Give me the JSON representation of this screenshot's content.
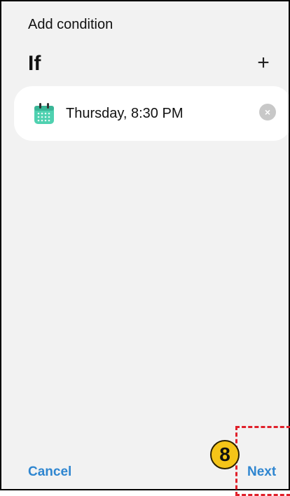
{
  "header": {
    "title": "Add condition"
  },
  "section": {
    "title": "If",
    "add_symbol": "+"
  },
  "condition": {
    "text": "Thursday, 8:30 PM",
    "icon": "calendar-icon",
    "clear_symbol": "×"
  },
  "footer": {
    "cancel_label": "Cancel",
    "next_label": "Next"
  },
  "annotation": {
    "step_number": "8"
  },
  "colors": {
    "accent": "#2f86d0",
    "calendar": "#4fd1b0",
    "highlight": "#e0202a",
    "badge": "#f5c518"
  }
}
